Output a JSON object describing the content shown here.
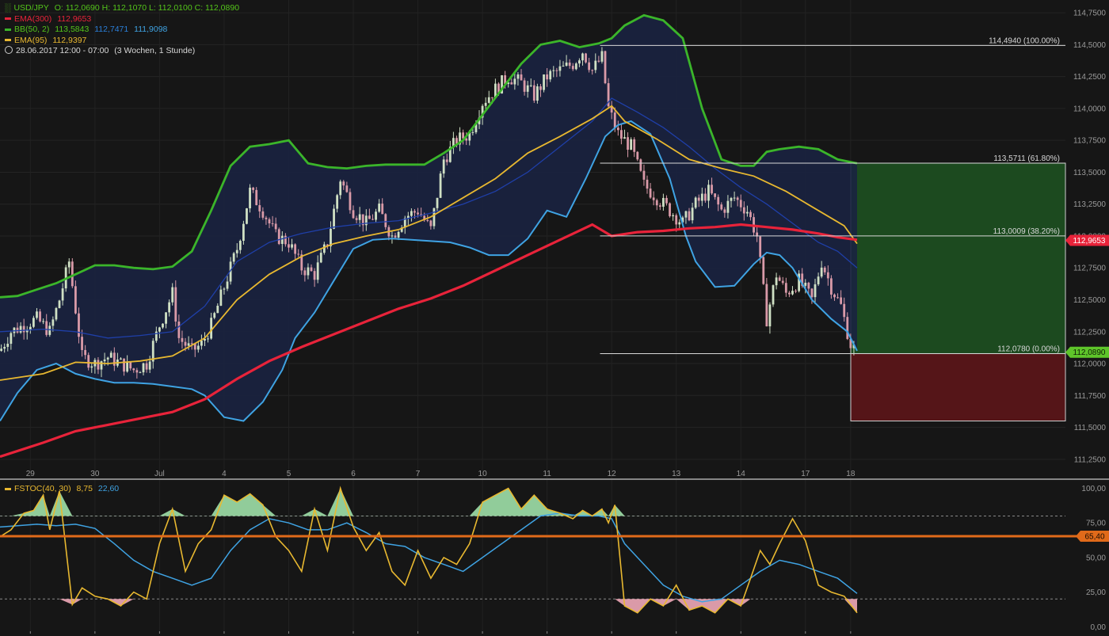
{
  "instrument": {
    "symbol": "USD/JPY",
    "ohlc_label": "O: 112,0690  H: 112,1070  L: 112,0100  C: 112,0890",
    "date_label": "28.06.2017 12:00 - 07:00",
    "range_label": "(3 Wochen, 1 Stunde)"
  },
  "indicators": {
    "ema300": {
      "label": "EMA(300)",
      "value": "112,9653",
      "color": "#e8233a"
    },
    "bb": {
      "label": "BB(50, 2)",
      "upper": "113,5843",
      "middle": "112,7471",
      "lower": "111,9098",
      "upper_color": "#3bb52a",
      "middle_color": "#1f3fa8",
      "lower_color": "#3fa3e3"
    },
    "ema95": {
      "label": "EMA(95)",
      "value": "112,9397",
      "color": "#e8b830"
    },
    "fstoc": {
      "label": "FSTOC(40, 30)",
      "k": "8,75",
      "d": "22,60",
      "k_color": "#e8b830",
      "d_color": "#3fa3e3"
    }
  },
  "badges": {
    "ema300": "112,9653",
    "last": "112,0890",
    "osc_line": "65,40"
  },
  "fib_labels": [
    {
      "value": 114.494,
      "text": "114,4940 (100.00%)"
    },
    {
      "value": 113.5711,
      "text": "113,5711 (61.80%)"
    },
    {
      "value": 113.0009,
      "text": "113,0009 (38.20%)"
    },
    {
      "value": 112.078,
      "text": "112,0780 (0.00%)"
    }
  ],
  "target_box": {
    "top": 113.5711,
    "entry": 112.078,
    "stop": 111.55
  },
  "chart_data": {
    "type": "line",
    "price_axis": {
      "ticks": [
        114.75,
        114.5,
        114.25,
        114.0,
        113.75,
        113.5,
        113.25,
        113.0,
        112.75,
        112.5,
        112.25,
        112.0,
        111.75,
        111.5,
        111.25
      ],
      "labels": [
        "114,7500",
        "114,5000",
        "114,2500",
        "114,0000",
        "113,7500",
        "113,5000",
        "113,2500",
        "113,0000",
        "112,7500",
        "112,5000",
        "112,2500",
        "112,0000",
        "111,7500",
        "111,5000",
        "111,2500"
      ],
      "range": [
        111.1,
        114.85
      ]
    },
    "x_axis": {
      "labels": [
        "29",
        "30",
        "Jul",
        "4",
        "5",
        "6",
        "7",
        "10",
        "11",
        "12",
        "13",
        "14",
        "17",
        "18"
      ],
      "positions": [
        0.8,
        1.8,
        2.8,
        3.8,
        4.8,
        5.8,
        6.8,
        7.8,
        8.8,
        9.8,
        10.8,
        11.8,
        12.8,
        13.5
      ],
      "range": [
        0.33,
        17.5
      ],
      "last_candle": 13.6
    },
    "osc_axis": {
      "ticks": [
        100,
        75,
        50,
        25,
        0
      ],
      "labels": [
        "100,00",
        "75,00",
        "50,00",
        "25,00",
        "0,00"
      ],
      "levels": [
        80,
        20
      ],
      "line": 65.4,
      "range": [
        -5,
        106
      ]
    },
    "series": [
      {
        "name": "BB upper",
        "x": [
          0.33,
          0.6,
          0.9,
          1.2,
          1.5,
          1.8,
          2.1,
          2.4,
          2.7,
          3.0,
          3.3,
          3.6,
          3.9,
          4.2,
          4.5,
          4.8,
          5.1,
          5.4,
          5.7,
          6.0,
          6.3,
          6.6,
          6.9,
          7.2,
          7.5,
          7.8,
          8.1,
          8.4,
          8.7,
          9.0,
          9.3,
          9.6,
          9.8,
          10.0,
          10.3,
          10.6,
          10.9,
          11.2,
          11.5,
          11.8,
          12.0,
          12.2,
          12.4,
          12.7,
          13.0,
          13.3,
          13.6
        ],
        "y": [
          112.52,
          112.53,
          112.58,
          112.63,
          112.7,
          112.77,
          112.77,
          112.75,
          112.74,
          112.76,
          112.88,
          113.2,
          113.55,
          113.7,
          113.72,
          113.75,
          113.57,
          113.54,
          113.53,
          113.55,
          113.56,
          113.56,
          113.56,
          113.65,
          113.75,
          113.95,
          114.15,
          114.35,
          114.5,
          114.53,
          114.48,
          114.51,
          114.55,
          114.65,
          114.73,
          114.69,
          114.55,
          114.0,
          113.6,
          113.55,
          113.55,
          113.66,
          113.68,
          113.7,
          113.68,
          113.6,
          113.57
        ]
      },
      {
        "name": "BB middle",
        "x": [
          0.33,
          1.0,
          1.5,
          2.0,
          2.5,
          3.0,
          3.5,
          4.0,
          4.5,
          5.0,
          5.5,
          6.0,
          6.5,
          7.0,
          7.5,
          8.0,
          8.5,
          9.0,
          9.5,
          9.8,
          10.2,
          10.6,
          11.0,
          11.4,
          11.8,
          12.2,
          12.6,
          13.0,
          13.3,
          13.6
        ],
        "y": [
          112.25,
          112.27,
          112.25,
          112.2,
          112.22,
          112.25,
          112.45,
          112.8,
          112.95,
          113.02,
          113.07,
          113.1,
          113.12,
          113.18,
          113.25,
          113.35,
          113.5,
          113.7,
          113.9,
          114.08,
          113.97,
          113.85,
          113.7,
          113.53,
          113.38,
          113.25,
          113.1,
          112.95,
          112.88,
          112.75
        ]
      },
      {
        "name": "BB lower",
        "x": [
          0.33,
          0.6,
          0.9,
          1.2,
          1.5,
          1.8,
          2.1,
          2.4,
          2.7,
          3.0,
          3.3,
          3.5,
          3.8,
          4.1,
          4.4,
          4.7,
          4.9,
          5.2,
          5.5,
          5.8,
          6.1,
          6.4,
          6.7,
          7.0,
          7.3,
          7.6,
          7.9,
          8.2,
          8.5,
          8.8,
          9.1,
          9.4,
          9.7,
          9.9,
          10.1,
          10.4,
          10.7,
          10.95,
          11.1,
          11.4,
          11.7,
          12.0,
          12.2,
          12.4,
          12.6,
          12.9,
          13.2,
          13.45,
          13.6
        ],
        "y": [
          111.55,
          111.77,
          111.95,
          112.0,
          111.92,
          111.88,
          111.85,
          111.85,
          111.84,
          111.82,
          111.8,
          111.75,
          111.58,
          111.55,
          111.7,
          111.95,
          112.2,
          112.4,
          112.65,
          112.9,
          112.97,
          112.98,
          112.97,
          112.96,
          112.95,
          112.91,
          112.85,
          112.85,
          112.98,
          113.2,
          113.15,
          113.45,
          113.78,
          113.87,
          113.9,
          113.8,
          113.45,
          113.0,
          112.8,
          112.6,
          112.61,
          112.78,
          112.87,
          112.85,
          112.75,
          112.5,
          112.35,
          112.25,
          112.1
        ]
      },
      {
        "name": "EMA 95",
        "x": [
          0.33,
          1.0,
          1.5,
          2.0,
          2.5,
          3.0,
          3.5,
          4.0,
          4.5,
          5.0,
          5.5,
          6.0,
          6.5,
          7.0,
          7.5,
          8.0,
          8.5,
          9.0,
          9.5,
          9.8,
          10.0,
          10.5,
          11.0,
          11.5,
          12.0,
          12.5,
          13.0,
          13.4,
          13.6
        ],
        "y": [
          111.87,
          111.92,
          112.01,
          112.0,
          112.02,
          112.06,
          112.2,
          112.5,
          112.7,
          112.84,
          112.94,
          113.0,
          113.05,
          113.15,
          113.3,
          113.45,
          113.65,
          113.78,
          113.92,
          114.02,
          113.9,
          113.76,
          113.6,
          113.53,
          113.47,
          113.35,
          113.2,
          113.08,
          112.94
        ]
      },
      {
        "name": "EMA 300",
        "x": [
          0.33,
          1.0,
          1.5,
          2.0,
          2.5,
          3.0,
          3.5,
          4.0,
          4.5,
          5.0,
          5.5,
          6.0,
          6.5,
          7.0,
          7.5,
          8.0,
          8.5,
          9.0,
          9.5,
          9.8,
          10.2,
          10.6,
          11.0,
          11.4,
          11.8,
          12.2,
          12.6,
          13.0,
          13.3,
          13.6
        ],
        "y": [
          111.27,
          111.38,
          111.47,
          111.52,
          111.57,
          111.62,
          111.72,
          111.88,
          112.02,
          112.13,
          112.23,
          112.33,
          112.43,
          112.51,
          112.61,
          112.73,
          112.85,
          112.97,
          113.09,
          113.0,
          113.03,
          113.04,
          113.06,
          113.07,
          113.09,
          113.07,
          113.05,
          113.02,
          112.99,
          112.97
        ]
      },
      {
        "name": "Close",
        "x": [
          0.33,
          0.5,
          0.7,
          0.9,
          1.1,
          1.25,
          1.4,
          1.6,
          1.8,
          2.0,
          2.2,
          2.4,
          2.6,
          2.8,
          3.0,
          3.1,
          3.3,
          3.45,
          3.6,
          3.8,
          4.0,
          4.2,
          4.4,
          4.6,
          4.8,
          5.0,
          5.2,
          5.4,
          5.6,
          5.8,
          6.0,
          6.2,
          6.4,
          6.6,
          6.8,
          7.0,
          7.2,
          7.4,
          7.6,
          7.8,
          8.0,
          8.2,
          8.4,
          8.6,
          8.8,
          9.0,
          9.2,
          9.35,
          9.5,
          9.65,
          9.75,
          9.9,
          10.1,
          10.3,
          10.5,
          10.7,
          10.9,
          11.1,
          11.3,
          11.5,
          11.7,
          11.9,
          12.05,
          12.2,
          12.35,
          12.5,
          12.7,
          12.9,
          13.05,
          13.2,
          13.35,
          13.5,
          13.6
        ],
        "y": [
          112.1,
          112.25,
          112.3,
          112.35,
          112.25,
          112.5,
          112.8,
          112.05,
          112.0,
          112.05,
          112.0,
          111.95,
          112.0,
          112.3,
          112.55,
          112.2,
          112.1,
          112.15,
          112.3,
          112.6,
          112.9,
          113.35,
          113.2,
          113.0,
          112.95,
          112.75,
          112.7,
          112.95,
          113.45,
          113.2,
          113.1,
          113.2,
          113.0,
          113.15,
          113.2,
          113.05,
          113.6,
          113.75,
          113.8,
          114.05,
          114.15,
          114.25,
          114.2,
          114.1,
          114.25,
          114.3,
          114.35,
          114.45,
          114.3,
          114.4,
          114.0,
          113.8,
          113.7,
          113.4,
          113.3,
          113.2,
          113.1,
          113.25,
          113.35,
          113.2,
          113.3,
          113.2,
          113.0,
          112.35,
          112.7,
          112.55,
          112.65,
          112.5,
          112.8,
          112.6,
          112.45,
          112.15,
          112.09
        ]
      }
    ],
    "oscillator": [
      {
        "name": "FSTOC %K",
        "x": [
          0.33,
          0.5,
          0.7,
          0.85,
          1.0,
          1.1,
          1.25,
          1.45,
          1.6,
          1.8,
          2.0,
          2.2,
          2.4,
          2.6,
          2.8,
          3.0,
          3.2,
          3.4,
          3.6,
          3.8,
          4.0,
          4.2,
          4.4,
          4.6,
          4.8,
          5.0,
          5.2,
          5.4,
          5.6,
          5.8,
          6.0,
          6.2,
          6.4,
          6.6,
          6.8,
          7.0,
          7.2,
          7.4,
          7.6,
          7.8,
          8.0,
          8.2,
          8.4,
          8.6,
          8.8,
          9.0,
          9.2,
          9.35,
          9.5,
          9.65,
          9.75,
          9.85,
          10.0,
          10.2,
          10.4,
          10.6,
          10.8,
          11.0,
          11.2,
          11.4,
          11.6,
          11.8,
          11.95,
          12.1,
          12.25,
          12.4,
          12.6,
          12.8,
          13.0,
          13.2,
          13.4,
          13.6
        ],
        "y": [
          65,
          70,
          82,
          84,
          95,
          70,
          98,
          16,
          28,
          22,
          20,
          15,
          25,
          20,
          60,
          85,
          40,
          60,
          70,
          95,
          90,
          96,
          88,
          65,
          55,
          40,
          85,
          55,
          100,
          72,
          55,
          68,
          40,
          30,
          55,
          35,
          50,
          45,
          60,
          90,
          95,
          100,
          85,
          95,
          85,
          82,
          78,
          84,
          80,
          85,
          75,
          88,
          15,
          10,
          20,
          15,
          30,
          12,
          15,
          10,
          20,
          15,
          35,
          55,
          45,
          60,
          78,
          62,
          30,
          25,
          22,
          10
        ]
      },
      {
        "name": "FSTOC %D",
        "x": [
          0.33,
          0.6,
          0.9,
          1.2,
          1.5,
          1.8,
          2.1,
          2.4,
          2.7,
          3.0,
          3.3,
          3.6,
          3.9,
          4.2,
          4.5,
          4.8,
          5.1,
          5.4,
          5.7,
          6.0,
          6.3,
          6.6,
          6.9,
          7.2,
          7.5,
          7.8,
          8.1,
          8.4,
          8.7,
          9.0,
          9.3,
          9.6,
          9.8,
          10.0,
          10.3,
          10.6,
          10.9,
          11.2,
          11.5,
          11.8,
          12.1,
          12.4,
          12.7,
          13.0,
          13.3,
          13.6
        ],
        "y": [
          72,
          73,
          74,
          73,
          74,
          71,
          60,
          48,
          40,
          35,
          30,
          35,
          55,
          70,
          78,
          75,
          70,
          70,
          75,
          68,
          60,
          58,
          50,
          45,
          40,
          50,
          60,
          70,
          80,
          82,
          80,
          80,
          78,
          60,
          45,
          30,
          22,
          18,
          20,
          30,
          40,
          48,
          45,
          40,
          35,
          24
        ]
      }
    ],
    "candles_step": 0.05,
    "title": "",
    "xlabel": "",
    "ylabel": ""
  }
}
